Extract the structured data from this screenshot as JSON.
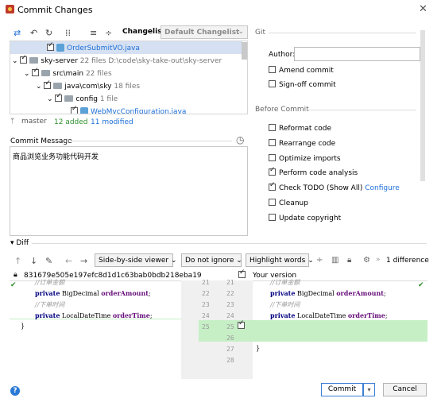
{
  "window": {
    "title": "Commit Changes",
    "close": "✕"
  },
  "toolbar": {
    "changelist_label": "Changelist:",
    "changelist_value": "Default Changelist"
  },
  "tree": {
    "rows": [
      {
        "name": "OrderSubmitVO.java",
        "extra": ""
      },
      {
        "name": "sky-server",
        "extra": "22 files  D:\\code\\sky-take-out\\sky-server"
      },
      {
        "name": "src\\main",
        "extra": "22 files"
      },
      {
        "name": "java\\com\\sky",
        "extra": "18 files"
      },
      {
        "name": "config",
        "extra": "1 file"
      },
      {
        "name": "WebMvcConfiguration.java",
        "extra": ""
      }
    ]
  },
  "branch": {
    "name": "master",
    "added": "12 added",
    "modified": "11 modified"
  },
  "commit_message": {
    "label": "Commit Message",
    "text": "商品浏览业务功能代码开发"
  },
  "git": {
    "section": "Git",
    "author_label": "Author:",
    "author_value": "",
    "amend": "Amend commit",
    "signoff": "Sign-off commit"
  },
  "before_commit": {
    "section": "Before Commit",
    "reformat": "Reformat code",
    "rearrange": "Rearrange code",
    "optimize": "Optimize imports",
    "analysis": "Perform code analysis",
    "todo": "Check TODO (Show All)",
    "configure": "Configure",
    "cleanup": "Cleanup",
    "copyright": "Update copyright"
  },
  "diff": {
    "label": "Diff",
    "viewer": "Side-by-side viewer",
    "whitespace": "Do not ignore",
    "highlight": "Highlight words",
    "count": "1 difference",
    "hash": "831679e505e197efc8d1d1c63bab0bdb218eba19",
    "your_version": "Your version",
    "left_lines": [
      {
        "n": "",
        "code_comment": "//订单金额"
      },
      {
        "n": "",
        "code_kw": "private",
        "code_type": " BigDecimal ",
        "code_field": "orderAmount",
        "code_end": ";"
      },
      {
        "n": "",
        "code_comment": "//下单时间"
      },
      {
        "n": "",
        "code_kw": "private",
        "code_type": " LocalDateTime ",
        "code_field": "orderTime",
        "code_end": ";"
      },
      {
        "n": "",
        "code_plain": "}"
      }
    ],
    "line_numbers_left": [
      "21",
      "22",
      "23",
      "24",
      "25",
      ""
    ],
    "line_numbers_right": [
      "21",
      "22",
      "23",
      "24",
      "25",
      "26",
      "27",
      "28"
    ],
    "right_close": "}"
  },
  "buttons": {
    "commit": "Commit",
    "cancel": "Cancel",
    "help": "?"
  }
}
